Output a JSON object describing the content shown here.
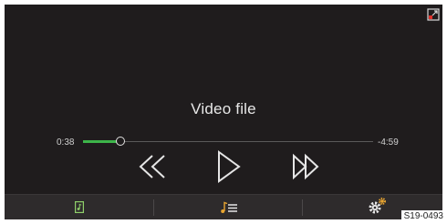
{
  "player": {
    "title": "Video file",
    "elapsed": "0:38",
    "remaining": "-4:59",
    "progress": 0.13,
    "accent_color": "#3db54a"
  },
  "controls": {
    "rewind_icon": "rewind-icon",
    "play_icon": "play-icon",
    "forward_icon": "fast-forward-icon"
  },
  "bottom_bar": {
    "tabs": [
      {
        "icon": "music-file-icon"
      },
      {
        "icon": "playlist-icon"
      },
      {
        "icon": "settings-icon"
      }
    ]
  },
  "reference_code": "S19-0493"
}
